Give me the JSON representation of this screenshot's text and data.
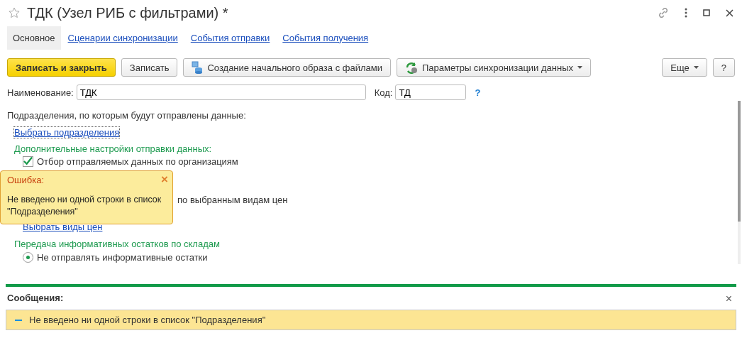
{
  "window": {
    "title": "ТДК (Узел РИБ с фильтрами) *",
    "favorite": false
  },
  "tabs": [
    {
      "label": "Основное",
      "selected": true
    },
    {
      "label": "Сценарии синхронизации",
      "selected": false
    },
    {
      "label": "События отправки",
      "selected": false
    },
    {
      "label": "События получения",
      "selected": false
    }
  ],
  "toolbar": [
    {
      "label": "Записать и закрыть",
      "kind": "primary"
    },
    {
      "label": "Записать",
      "kind": "plain"
    },
    {
      "label": "Создание начального образа с файлами",
      "kind": "image"
    },
    {
      "label": "Параметры синхронизации данных",
      "kind": "sync"
    }
  ],
  "toolbar_right": [
    {
      "label": "Еще",
      "kind": "menu"
    },
    {
      "label": "?",
      "kind": "plain"
    }
  ],
  "fields": [
    {
      "label": "Наименование:",
      "value": "ТДК"
    },
    {
      "label": "Код:",
      "value": "ТД",
      "help": "?"
    }
  ],
  "form": [
    {
      "kind": "text",
      "text": "Подразделения, по которым будут отправлены данные:"
    },
    {
      "kind": "link",
      "text": "Выбрать подразделения"
    },
    {
      "kind": "heading",
      "text": "Дополнительные настройки отправки данных:"
    },
    {
      "kind": "checkbox",
      "text": "Отбор отправляемых данных по организациям",
      "checked": true
    },
    {
      "kind": "covered",
      "text": "по выбранным видам цен"
    },
    {
      "kind": "sublink",
      "text": "Выбрать виды цен"
    },
    {
      "kind": "heading",
      "text": "Передача информативных остатков по складам"
    },
    {
      "kind": "radio",
      "text": "Не отправлять информативные остатки",
      "selected": true
    }
  ],
  "error_popup": {
    "title": "Ошибка:",
    "close": "×",
    "text": "Не введено ни одной строки в список \"Подразделения\""
  },
  "messages": {
    "title": "Сообщения:",
    "close": "×",
    "items": [
      "Не введено ни одной строки в список \"Подразделения\""
    ]
  }
}
